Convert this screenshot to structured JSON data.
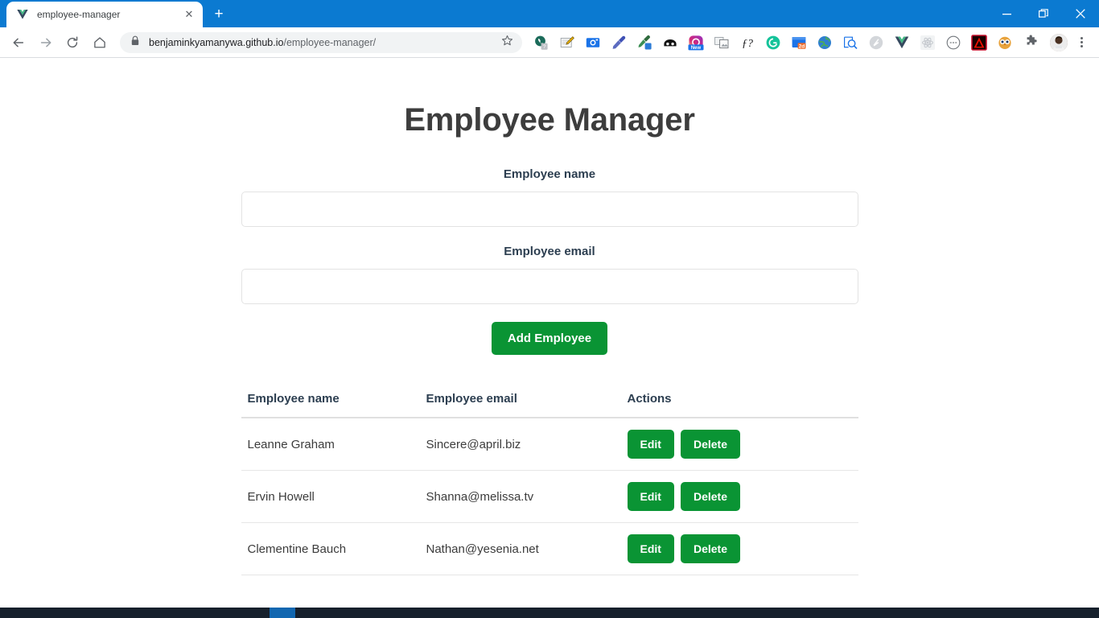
{
  "browser": {
    "tab": {
      "title": "employee-manager",
      "favicon": "vue-logo-icon",
      "close_label": "✕"
    },
    "new_tab_label": "+",
    "window_controls": {
      "minimize": "–",
      "restore": "❐",
      "close": "✕"
    },
    "nav": {
      "back": "←",
      "forward": "→",
      "reload": "⟳",
      "home": "⌂"
    },
    "omnibox": {
      "lock_icon": "padlock-icon",
      "url_host": "benjaminkyamanywa.github.io",
      "url_path": "/employee-manager/",
      "bookmark_icon": "☆"
    },
    "extensions": [
      {
        "name": "whatsapp-help-icon",
        "glyph": ""
      },
      {
        "name": "notes-pencil-icon",
        "glyph": ""
      },
      {
        "name": "screenshot-camera-icon",
        "glyph": ""
      },
      {
        "name": "color-picker-icon",
        "glyph": ""
      },
      {
        "name": "eyedropper-blue-icon",
        "glyph": ""
      },
      {
        "name": "dark-reader-icon",
        "glyph": ""
      },
      {
        "name": "instagram-new-icon",
        "glyph": "New"
      },
      {
        "name": "window-capture-icon",
        "glyph": ""
      },
      {
        "name": "fonts-ninja-icon",
        "glyph": "ƒ?"
      },
      {
        "name": "grammarly-icon",
        "glyph": "G"
      },
      {
        "name": "2d-design-icon",
        "glyph": "2d"
      },
      {
        "name": "globe-translate-icon",
        "glyph": ""
      },
      {
        "name": "page-inspect-icon",
        "glyph": ""
      },
      {
        "name": "ghostery-icon",
        "glyph": ""
      },
      {
        "name": "vue-devtools-icon",
        "glyph": ""
      },
      {
        "name": "react-devtools-icon",
        "glyph": ""
      },
      {
        "name": "circle-dashes-icon",
        "glyph": ""
      },
      {
        "name": "adobe-acrobat-icon",
        "glyph": ""
      },
      {
        "name": "owl-extension-icon",
        "glyph": ""
      },
      {
        "name": "extensions-puzzle-icon",
        "glyph": ""
      }
    ],
    "profile": {
      "name": "profile-avatar"
    },
    "menu": {
      "name": "chrome-menu-icon"
    }
  },
  "page": {
    "title": "Employee Manager",
    "form": {
      "name_label": "Employee name",
      "name_value": "",
      "name_placeholder": "",
      "email_label": "Employee email",
      "email_value": "",
      "email_placeholder": "",
      "submit_label": "Add Employee"
    },
    "table": {
      "headers": [
        "Employee name",
        "Employee email",
        "Actions"
      ],
      "rows": [
        {
          "name": "Leanne Graham",
          "email": "Sincere@april.biz",
          "edit_label": "Edit",
          "delete_label": "Delete"
        },
        {
          "name": "Ervin Howell",
          "email": "Shanna@melissa.tv",
          "edit_label": "Edit",
          "delete_label": "Delete"
        },
        {
          "name": "Clementine Bauch",
          "email": "Nathan@yesenia.net",
          "edit_label": "Edit",
          "delete_label": "Delete"
        }
      ]
    }
  },
  "colors": {
    "browser_chrome_blue": "#0b7ad1",
    "accent_green": "#0a9434",
    "heading_gray": "#3d3d3d",
    "label_navy": "#2c3e50",
    "taskbar_dark": "#16202c",
    "taskbar_active_blue": "#1267b0"
  }
}
